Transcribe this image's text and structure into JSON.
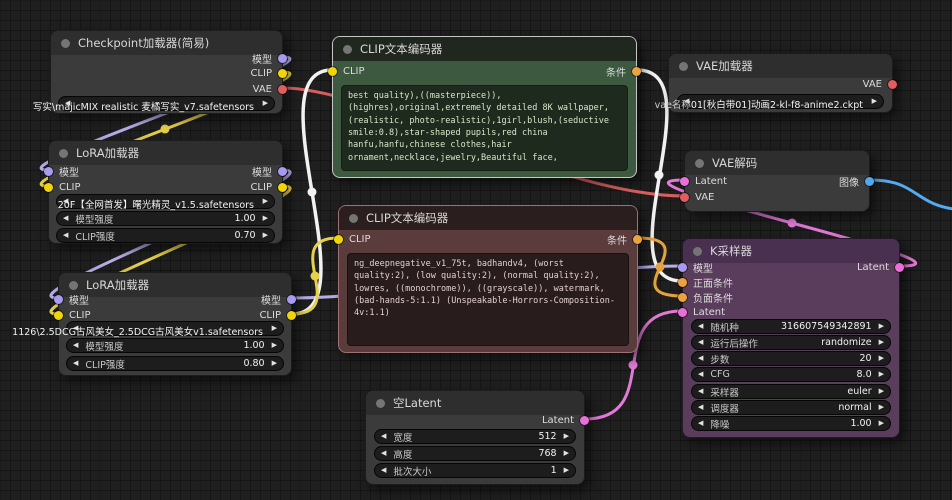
{
  "app": "ComfyUI node graph",
  "palette": {
    "slot_model": "#a79af0",
    "slot_clip": "#f0d50a",
    "slot_vae": "#e25d5d",
    "slot_conditioning": "#eda33d",
    "slot_latent": "#ea6fd8",
    "slot_image": "#52a8f0",
    "link_model": "#b6aee8",
    "link_clip": "#e6d049",
    "link_vae": "#d95f5f",
    "link_conditioning_neg": "#e6a23c",
    "link_white": "#f2f2f2",
    "link_latent": "#e27ad8",
    "link_image": "#55aaf0",
    "node_green": "#3d5a40",
    "node_red": "#5a3c3c",
    "node_purple": "#5a3d5c",
    "node_gray": "#3b3b3b",
    "canvas_bg": "#1f1f1f"
  },
  "nodes": {
    "checkpoint": {
      "title": "Checkpoint加载器(简易)",
      "outputs": [
        "模型",
        "CLIP",
        "VAE"
      ],
      "file": "写实\\majicMIX realistic 麦橘写实_v7.safetensors"
    },
    "lora1": {
      "title": "LoRA加载器",
      "inputs": [
        "模型",
        "CLIP"
      ],
      "outputs": [
        "模型",
        "CLIP"
      ],
      "file": "20F【全网首发】曙光精灵_v1.5.safetensors",
      "params": [
        {
          "label": "模型强度",
          "value": "1.00"
        },
        {
          "label": "CLIP强度",
          "value": "0.70"
        }
      ]
    },
    "lora2": {
      "title": "LoRA加载器",
      "inputs": [
        "模型",
        "CLIP"
      ],
      "outputs": [
        "模型",
        "CLIP"
      ],
      "file": "1126\\2.5DCG古风美女_2.5DCG古风美女v1.safetensors",
      "params": [
        {
          "label": "模型强度",
          "value": "1.00"
        },
        {
          "label": "CLIP强度",
          "value": "0.80"
        }
      ]
    },
    "clip_pos": {
      "title": "CLIP文本编码器",
      "inputs": [
        "CLIP"
      ],
      "outputs": [
        "条件"
      ],
      "text": "best quality),((masterpiece)),(highres),original,extremely detailed 8K wallpaper,(realistic, photo-realistic),1girl,blush,(seductive smile:0.8),star-shaped pupils,red china hanfu,hanfu,chinese clothes,hair ornament,necklace,jewelry,Beautiful face,"
    },
    "clip_neg": {
      "title": "CLIP文本编码器",
      "inputs": [
        "CLIP"
      ],
      "outputs": [
        "条件"
      ],
      "text": "ng_deepnegative_v1_75t, badhandv4, (worst quality:2), (low quality:2), (normal quality:2), lowres, ((monochrome)), ((grayscale)), watermark, (bad-hands-5:1.1) (Unspeakable-Horrors-Composition-4v:1.1)"
    },
    "vae_loader": {
      "title": "VAE加载器",
      "outputs": [
        "VAE"
      ],
      "file_label": "vae名称",
      "file": "01[秋白带01]动画2-kl-f8-anime2.ckpt"
    },
    "vae_decode": {
      "title": "VAE解码",
      "inputs": [
        "Latent",
        "VAE"
      ],
      "outputs": [
        "图像"
      ]
    },
    "ksampler": {
      "title": "K采样器",
      "inputs": [
        "模型",
        "正面条件",
        "负面条件",
        "Latent"
      ],
      "outputs": [
        "Latent"
      ],
      "params": [
        {
          "label": "随机种",
          "value": "316607549342891"
        },
        {
          "label": "运行后操作",
          "value": "randomize"
        },
        {
          "label": "步数",
          "value": "20"
        },
        {
          "label": "CFG",
          "value": "8.0"
        },
        {
          "label": "采样器",
          "value": "euler"
        },
        {
          "label": "调度器",
          "value": "normal"
        },
        {
          "label": "降噪",
          "value": "1.00"
        }
      ]
    },
    "empty_latent": {
      "title": "空Latent",
      "outputs": [
        "Latent"
      ],
      "params": [
        {
          "label": "宽度",
          "value": "512"
        },
        {
          "label": "高度",
          "value": "768"
        },
        {
          "label": "批次大小",
          "value": "1"
        }
      ]
    }
  }
}
